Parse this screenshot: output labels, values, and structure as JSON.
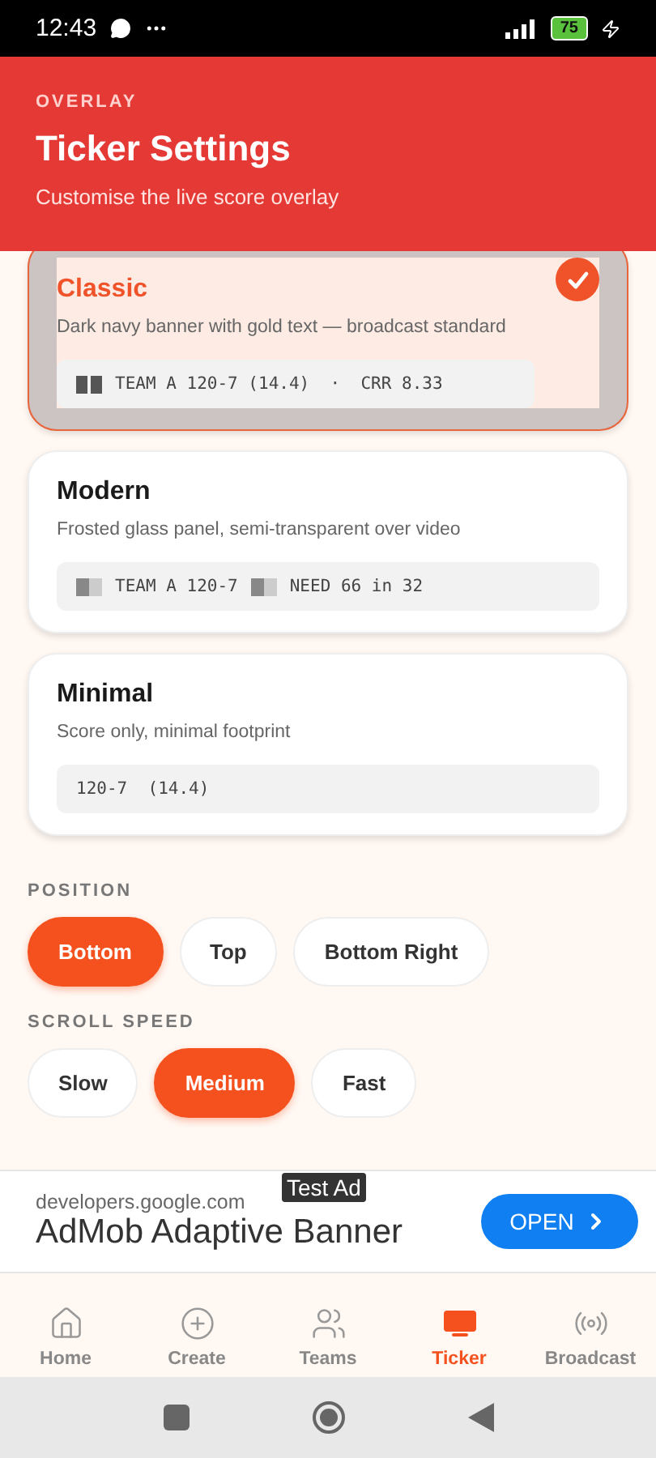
{
  "status_bar": {
    "time": "12:43",
    "battery": "75"
  },
  "header": {
    "eyebrow": "OVERLAY",
    "title": "Ticker Settings",
    "subtitle": "Customise the live score overlay"
  },
  "styles": [
    {
      "name": "Classic",
      "description": "Dark navy banner with gold text — broadcast standard",
      "selected": true,
      "preview": [
        {
          "kind": "dark_swatch"
        },
        {
          "kind": "text",
          "text": "TEAM A 120-7 (14.4)  ·  CRR 8.33"
        }
      ]
    },
    {
      "name": "Modern",
      "description": "Frosted glass panel, semi-transparent over video",
      "selected": false,
      "preview": [
        {
          "kind": "light_swatch"
        },
        {
          "kind": "text",
          "text": "TEAM A 120-7"
        },
        {
          "kind": "light_swatch"
        },
        {
          "kind": "text",
          "text": "NEED 66 in 32"
        }
      ]
    },
    {
      "name": "Minimal",
      "description": "Score only, minimal footprint",
      "selected": false,
      "preview": [
        {
          "kind": "text",
          "text": "120-7  (14.4)"
        }
      ]
    }
  ],
  "option_groups": [
    {
      "label": "POSITION",
      "options": [
        {
          "label": "Bottom",
          "selected": true
        },
        {
          "label": "Top",
          "selected": false
        },
        {
          "label": "Bottom Right",
          "selected": false
        }
      ]
    },
    {
      "label": "SCROLL SPEED",
      "options": [
        {
          "label": "Slow",
          "selected": false
        },
        {
          "label": "Medium",
          "selected": true
        },
        {
          "label": "Fast",
          "selected": false
        }
      ]
    }
  ],
  "ad": {
    "badge": "Test Ad",
    "domain": "developers.google.com",
    "title": "AdMob Adaptive Banner",
    "button": "OPEN"
  },
  "nav": [
    {
      "label": "Home",
      "selected": false
    },
    {
      "label": "Create",
      "selected": false
    },
    {
      "label": "Teams",
      "selected": false
    },
    {
      "label": "Ticker",
      "selected": true
    },
    {
      "label": "Broadcast",
      "selected": false
    }
  ]
}
